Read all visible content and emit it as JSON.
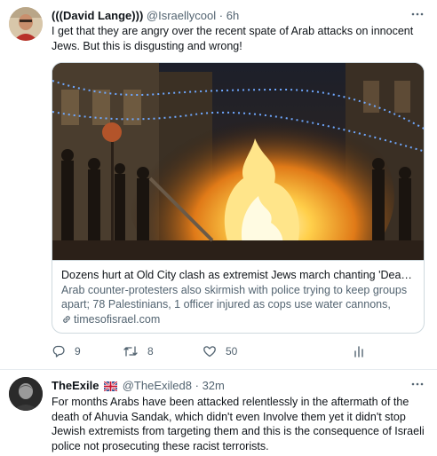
{
  "tweets": [
    {
      "author_name": "(((David Lange)))",
      "handle": "@Israellycool",
      "separator": "·",
      "time": "6h",
      "text": "I get that they are angry over the recent spate of Arab attacks on innocent Jews. But this is disgusting and wrong!",
      "card": {
        "title": "Dozens hurt at Old City clash as extremist Jews march chanting 'Death ...",
        "description": "Arab counter-protesters also skirmish with police trying to keep groups apart; 78 Palestinians, 1 officer injured as cops use water cannons, stun...",
        "domain": "timesofisrael.com"
      },
      "actions": {
        "reply_count": "9",
        "retweet_count": "8",
        "like_count": "50"
      }
    },
    {
      "author_name": "TheExile",
      "flag": "🇬🇧",
      "handle": "@TheExiled8",
      "separator": "·",
      "time": "32m",
      "text": "For months Arabs have been attacked relentlessly in the aftermath of the death of Ahuvia Sandak, which didn't even Involve them yet it didn't stop Jewish extremists from targeting them and this is the consequence of Israeli police not prosecuting these racist terrorists."
    }
  ],
  "icons": {
    "more": "more-icon",
    "reply": "reply-icon",
    "retweet": "retweet-icon",
    "like": "heart-icon",
    "analytics": "analytics-icon",
    "link": "link-icon"
  },
  "colors": {
    "text_primary": "#0f1419",
    "text_secondary": "#536471",
    "border": "#cfd9de"
  }
}
